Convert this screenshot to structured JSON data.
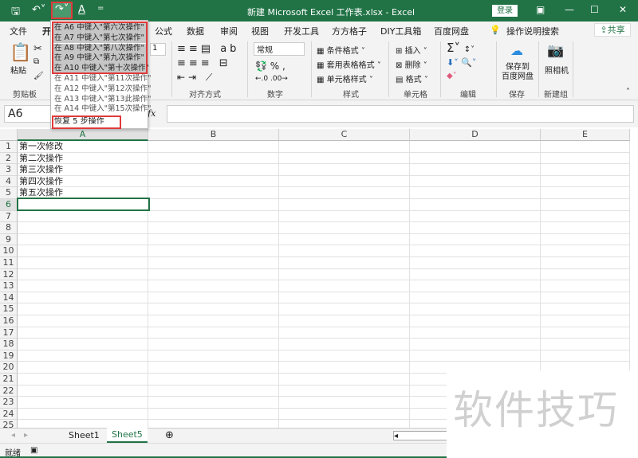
{
  "titlebar": {
    "title": "新建 Microsoft Excel 工作表.xlsx  -  Excel",
    "login": "登录",
    "save_icon": "save-icon",
    "undo_icon": "undo-icon",
    "redo_icon": "redo-icon",
    "font_color_icon": "font-color-icon"
  },
  "tabs": [
    "文件",
    "开始",
    "公式",
    "数据",
    "审阅",
    "视图",
    "开发工具",
    "方方格子",
    "DIY工具箱",
    "百度网盘",
    "操作说明搜索"
  ],
  "share": "共享",
  "ribbon": {
    "clipboard": {
      "paste": "粘贴",
      "label": "剪贴板"
    },
    "alignment": {
      "label": "对齐方式"
    },
    "number": {
      "format": "常规",
      "label": "数字"
    },
    "styles": {
      "items": [
        "条件格式 ˅",
        "套用表格格式 ˅",
        "单元格样式 ˅"
      ],
      "label": "样式"
    },
    "cells": {
      "items": [
        "插入",
        "删除",
        "格式"
      ],
      "label": "单元格"
    },
    "editing": {
      "label": "编辑"
    },
    "save": {
      "button": "保存到\n百度网盘",
      "label": "保存"
    },
    "camera": {
      "button": "照相机",
      "label": "新建组"
    },
    "font_size": "1"
  },
  "formula": {
    "namebox": "A6",
    "fx": "fx",
    "value": ""
  },
  "redo_menu": {
    "items": [
      "在 A6 中键入\"第六次操作\"",
      "在 A7 中键入\"第七次操作\"",
      "在 A8 中键入\"第八次操作\"",
      "在 A9 中键入\"第九次操作\"",
      "在 A10 中键入\"第十次操作\"",
      "在 A11 中键入\"第11次操作\"",
      "在 A12 中键入\"第12次操作\"",
      "在 A13 中键入\"第13此操作\"",
      "在 A14 中键入\"第15次操作\""
    ],
    "footer": "恢复 5 步操作"
  },
  "grid": {
    "columns": [
      "A",
      "B",
      "C",
      "D",
      "E"
    ],
    "rows": [
      "1",
      "2",
      "3",
      "4",
      "5",
      "6",
      "7",
      "8",
      "9",
      "10",
      "11",
      "12",
      "13",
      "14",
      "15",
      "16",
      "17",
      "18",
      "19",
      "20",
      "21",
      "22",
      "23",
      "24",
      "25"
    ],
    "cells": [
      "第一次修改",
      "第二次操作",
      "第三次操作",
      "第四次操作",
      "第五次操作"
    ],
    "selected": "A6"
  },
  "sheets": {
    "tabs": [
      "Sheet1",
      "Sheet5"
    ],
    "active": "Sheet5"
  },
  "status": {
    "text": "就绪"
  },
  "watermark": "软件技巧",
  "colors": {
    "accent": "#217346",
    "highlight": "#e03a3a"
  }
}
